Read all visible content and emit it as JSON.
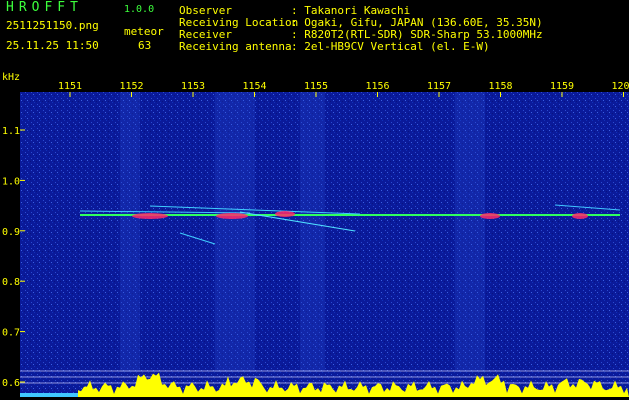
{
  "header": {
    "app_name": "HROFFT",
    "version": "1.0.0",
    "filename": "2511251150.png",
    "datetime": "25.11.25 11:50",
    "meteor_label": "meteor",
    "meteor_count": "63",
    "info_rows": [
      {
        "label": "Observer",
        "value": ": Takanori Kawachi"
      },
      {
        "label": "Receiving Location",
        "value": ": Ogaki, Gifu, JAPAN (136.60E, 35.35N)"
      },
      {
        "label": "Receiver",
        "value": ": R820T2(RTL-SDR) SDR-Sharp 53.1000MHz"
      },
      {
        "label": "Receiving antenna",
        "value": ": 2el-HB9CV Vertical (el. E-W)"
      }
    ]
  },
  "spectrogram": {
    "y_unit": "kHz",
    "y_ticks": [
      "1.1",
      "1.0",
      "0.9",
      "0.8",
      "0.7",
      "0.6"
    ],
    "x_ticks": [
      "1151",
      "1152",
      "1153",
      "1154",
      "1155",
      "1156",
      "1157",
      "1158",
      "1159",
      "1200"
    ],
    "colors": {
      "background": "#0a1a9a",
      "signal": "#30ff60",
      "hot": "#ff2a6a",
      "level": "#ffff00",
      "header_green": "#3cff3c",
      "header_yellow": "#ffff00"
    }
  }
}
